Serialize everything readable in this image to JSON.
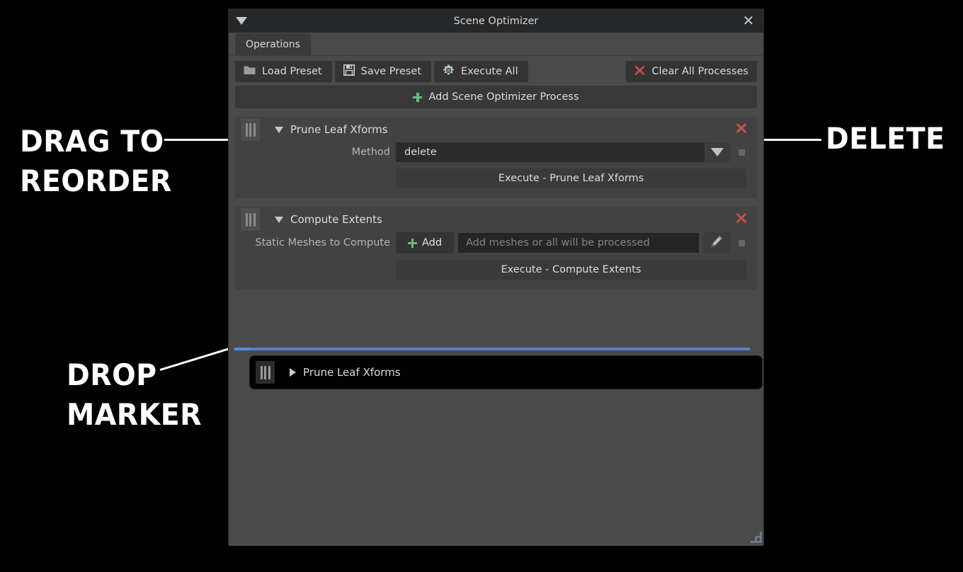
{
  "window": {
    "title": "Scene Optimizer",
    "collapse_icon": "triangle-down-icon",
    "close_icon": "close-icon"
  },
  "tabs": [
    {
      "label": "Operations"
    }
  ],
  "toolbar": {
    "load_preset": "Load Preset",
    "save_preset": "Save Preset",
    "execute_all": "Execute All",
    "clear_all": "Clear All Processes",
    "icons": {
      "load_preset": "folder-icon",
      "save_preset": "floppy-disk-icon",
      "execute_all": "gear-icon",
      "clear_all": "red-x-icon"
    }
  },
  "add_process": {
    "label": "Add Scene Optimizer Process",
    "icon": "plus-icon"
  },
  "processes": [
    {
      "title": "Prune Leaf Xforms",
      "expanded": true,
      "expand_icon": "triangle-down-icon",
      "grip_icon": "drag-handle-icon",
      "delete_icon": "red-x-icon",
      "fields": [
        {
          "label": "Method",
          "type": "combo",
          "value": "delete",
          "arrow_icon": "triangle-down-icon",
          "reset_icon": "reset-square-icon"
        }
      ],
      "execute_label": "Execute - Prune Leaf Xforms"
    },
    {
      "title": "Compute Extents",
      "expanded": true,
      "expand_icon": "triangle-down-icon",
      "grip_icon": "drag-handle-icon",
      "delete_icon": "red-x-icon",
      "fields": [
        {
          "label": "Static Meshes to Compute",
          "type": "mesh-picker",
          "add_label": "Add",
          "add_icon": "plus-icon",
          "placeholder": "Add meshes or all will be processed",
          "value": "",
          "edit_icon": "pencil-icon",
          "reset_icon": "reset-square-icon"
        }
      ],
      "execute_label": "Execute - Compute Extents"
    }
  ],
  "drag_ghost": {
    "title": "Prune Leaf Xforms",
    "expand_icon": "triangle-right-icon",
    "grip_icon": "drag-handle-icon"
  },
  "drop_marker": {
    "color": "#4a90e2"
  },
  "annotations": [
    {
      "id": "drag-to-reorder",
      "line1": "DRAG TO",
      "line2": "REORDER"
    },
    {
      "id": "delete",
      "line1": "DELETE",
      "line2": ""
    },
    {
      "id": "drop-marker",
      "line1": "DROP",
      "line2": "MARKER"
    }
  ],
  "colors": {
    "accent_blue": "#4a90e2",
    "danger_red": "#c0504a",
    "success_green": "#6fbb72",
    "window_bg": "#4a4a4a",
    "titlebar_bg": "#262729"
  }
}
